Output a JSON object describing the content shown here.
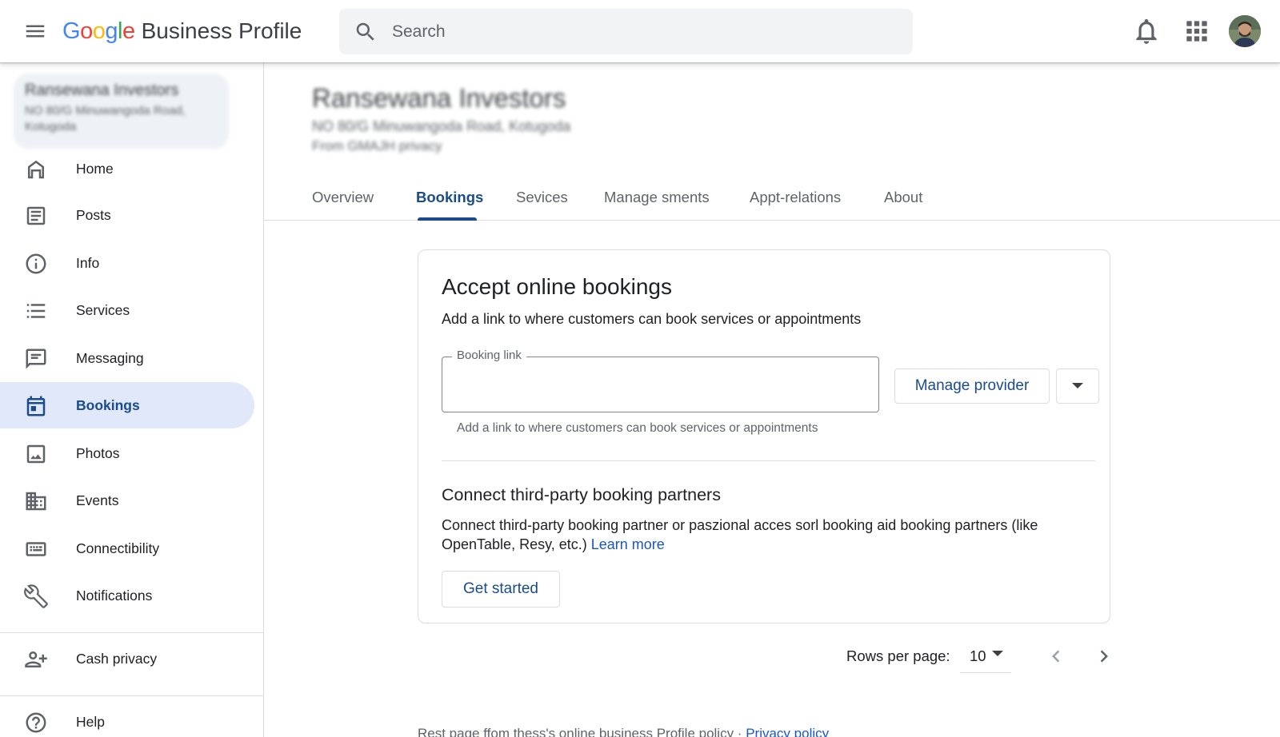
{
  "header": {
    "logo_letters": [
      "G",
      "o",
      "o",
      "g",
      "l",
      "e"
    ],
    "product_name": "Business Profile",
    "search_placeholder": "Search"
  },
  "sidebar": {
    "business_name": "Ransewana Investors",
    "business_address": "NO 80/G Minuwangoda Road, Kotugoda",
    "items": [
      {
        "label": "Home",
        "icon": "home-icon"
      },
      {
        "label": "Posts",
        "icon": "posts-icon"
      },
      {
        "label": "Info",
        "icon": "info-icon"
      },
      {
        "label": "Services",
        "icon": "list-icon"
      },
      {
        "label": "Messaging",
        "icon": "message-icon"
      },
      {
        "label": "Bookings",
        "icon": "calendar-icon",
        "active": true
      },
      {
        "label": "Photos",
        "icon": "image-icon"
      },
      {
        "label": "Events",
        "icon": "building-icon"
      },
      {
        "label": "Connectibility",
        "icon": "keyboard-icon"
      },
      {
        "label": "Notifications",
        "icon": "wrench-icon"
      }
    ],
    "lower_items": [
      {
        "label": "Cash privacy",
        "icon": "add-person-icon"
      },
      {
        "label": "Help",
        "icon": "help-icon"
      }
    ]
  },
  "main": {
    "business_title": "Ransewana Investors",
    "business_address": "NO 80/G Minuwangoda Road, Kotugoda",
    "business_note": "From GMAJH privacy",
    "tabs": [
      "Overview",
      "Bookings",
      "Sevices",
      "Manage sments",
      "Appt-relations",
      "About"
    ],
    "active_tab": "Bookings"
  },
  "card": {
    "title": "Accept online bookings",
    "subtitle": "Add a link to where customers can book services or appointments",
    "field_label": "Booking link",
    "field_value": "",
    "helper_text": "Add a link to where customers can book services or appointments",
    "manage_provider_label": "Manage provider",
    "partners_title": "Connect third-party booking partners",
    "partners_desc": "Connect third-party booking partner or paszional acces sorl booking aid booking partners (like OpenTable, Resy, etc.)",
    "learn_more": "Learn more",
    "get_started_label": "Get started"
  },
  "pager": {
    "rows_label": "Rows per page:",
    "rows_value": "10"
  },
  "footer": {
    "text": "Rest page ffom thess's online business Profile policy ·",
    "link": "Privacy policy"
  },
  "colors": {
    "accent": "#1a4c8b",
    "active_bg": "#e0e8f9",
    "link": "#1a56c8",
    "google_blue": "#4285F4",
    "google_red": "#EA4335",
    "google_yellow": "#FBBC05",
    "google_green": "#34A853"
  }
}
